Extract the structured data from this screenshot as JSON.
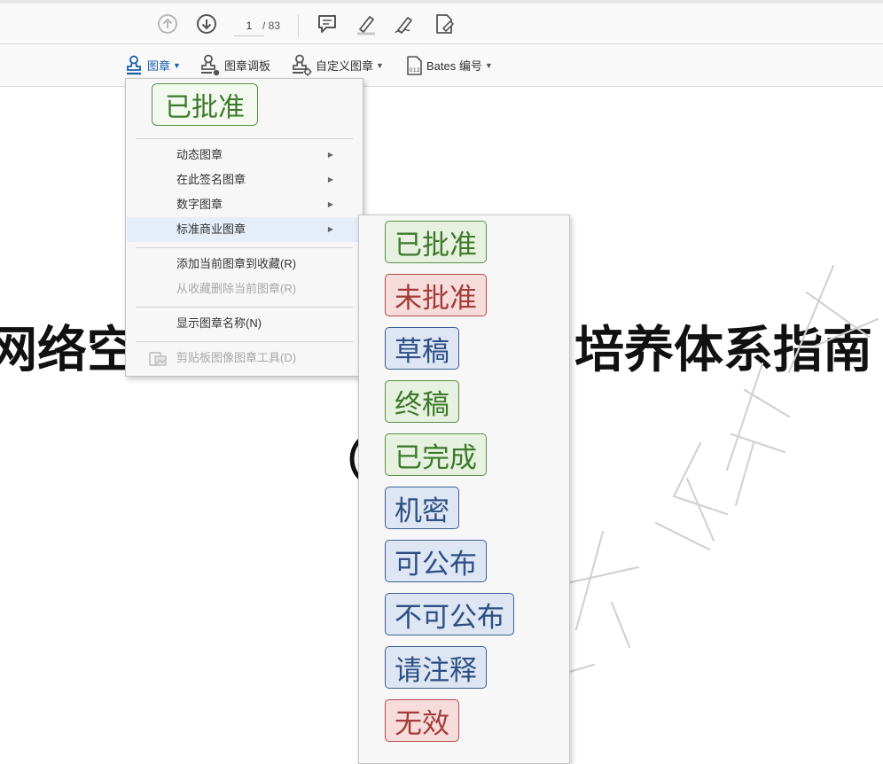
{
  "nav_toolbar": {
    "current_page": "1",
    "total_pages": "/ 83",
    "icons": [
      "arrow-up-circle",
      "arrow-down-circle",
      "comment",
      "highlighter-pen",
      "sign-pen",
      "fill-sign"
    ]
  },
  "stamp_toolbar": {
    "stamps_label": "图章",
    "stamp_palette_label": "图章调板",
    "custom_stamp_label": "自定义图章",
    "bates_label": "Bates 编号",
    "accent_color": "#1a5fa8"
  },
  "document": {
    "title_left": "网络空",
    "title_right": "培养体系指南",
    "subtitle": "（"
  },
  "stamp_menu": {
    "recent_stamp": "已批准",
    "items": [
      {
        "label": "动态图章",
        "submenu": true
      },
      {
        "label": "在此签名图章",
        "submenu": true
      },
      {
        "label": "数字图章",
        "submenu": true
      },
      {
        "label": "标准商业图章",
        "submenu": true,
        "highlighted": true
      }
    ],
    "add_favorite": "添加当前图章到收藏(R)",
    "remove_favorite": "从收藏删除当前图章(R)",
    "show_names": "显示图章名称(N)",
    "clipboard_tool": "剪贴板图像图章工具(D)"
  },
  "standard_business_stamps": [
    {
      "label": "已批准",
      "color": "green"
    },
    {
      "label": "未批准",
      "color": "red"
    },
    {
      "label": "草稿",
      "color": "blue"
    },
    {
      "label": "终稿",
      "color": "green"
    },
    {
      "label": "已完成",
      "color": "green"
    },
    {
      "label": "机密",
      "color": "blue"
    },
    {
      "label": "可公布",
      "color": "blue"
    },
    {
      "label": "不可公布",
      "color": "blue"
    },
    {
      "label": "请注释",
      "color": "blue"
    },
    {
      "label": "无效",
      "color": "red"
    }
  ]
}
